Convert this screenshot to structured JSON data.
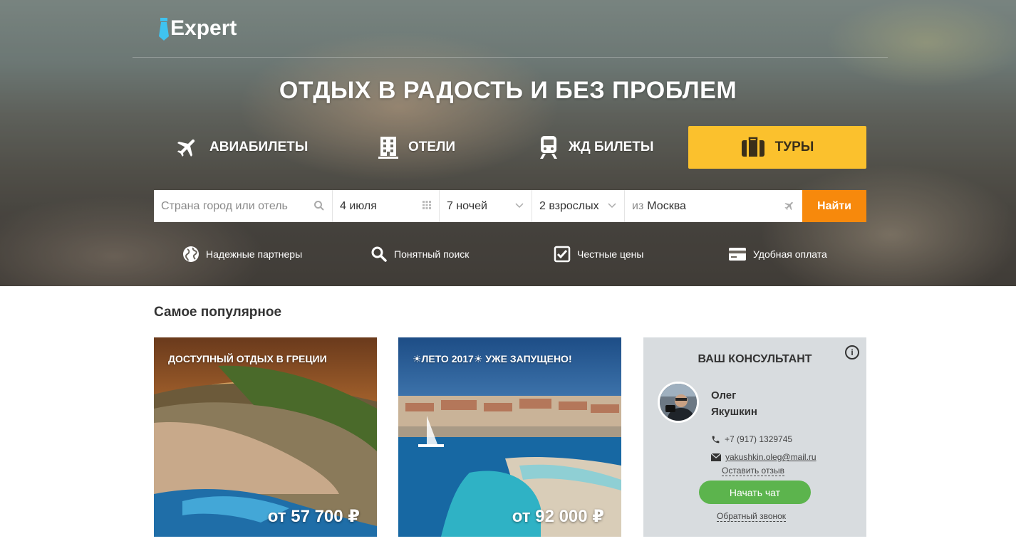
{
  "brand": {
    "logo_text": "Expert"
  },
  "hero": {
    "headline": "ОТДЫХ В РАДОСТЬ И БЕЗ ПРОБЛЕМ"
  },
  "tabs": [
    {
      "label": "АВИАБИЛЕТЫ",
      "icon": "airplane-icon"
    },
    {
      "label": "ОТЕЛИ",
      "icon": "hotel-icon"
    },
    {
      "label": "ЖД БИЛЕТЫ",
      "icon": "train-icon"
    },
    {
      "label": "ТУРЫ",
      "icon": "suitcase-icon",
      "active": true
    }
  ],
  "search": {
    "destination_placeholder": "Страна город или отель",
    "date": "4 июля",
    "nights": "7 ночей",
    "adults": "2 взрослых",
    "from_prefix": "из",
    "from_city": "Москва",
    "submit_label": "Найти"
  },
  "features": [
    {
      "label": "Надежные партнеры",
      "icon": "globe-icon"
    },
    {
      "label": "Понятный поиск",
      "icon": "search-icon"
    },
    {
      "label": "Честные цены",
      "icon": "checkbox-icon"
    },
    {
      "label": "Удобная оплата",
      "icon": "credit-card-icon"
    }
  ],
  "popular": {
    "title": "Самое популярное",
    "cards": [
      {
        "title": "ДОСТУПНЫЙ ОТДЫХ В ГРЕЦИИ",
        "price": "от 57 700 ₽"
      },
      {
        "title": "☀ЛЕТО 2017☀ УЖЕ ЗАПУЩЕНО!",
        "price": "от 92 000 ₽"
      }
    ]
  },
  "consultant": {
    "title": "ВАШ КОНСУЛЬТАНТ",
    "info_label": "i",
    "first_name": "Олег",
    "last_name": "Якушкин",
    "phone": "+7 (917) 1329745",
    "email": "yakushkin.oleg@mail.ru",
    "review_link": "Оставить отзыв",
    "chat_button": "Начать чат",
    "callback_link": "Обратный звонок"
  },
  "colors": {
    "tours_tab": "#fbc12d",
    "find_button": "#f7890c",
    "chat_button": "#5cb44d",
    "consultant_bg": "#d8dcdf"
  }
}
